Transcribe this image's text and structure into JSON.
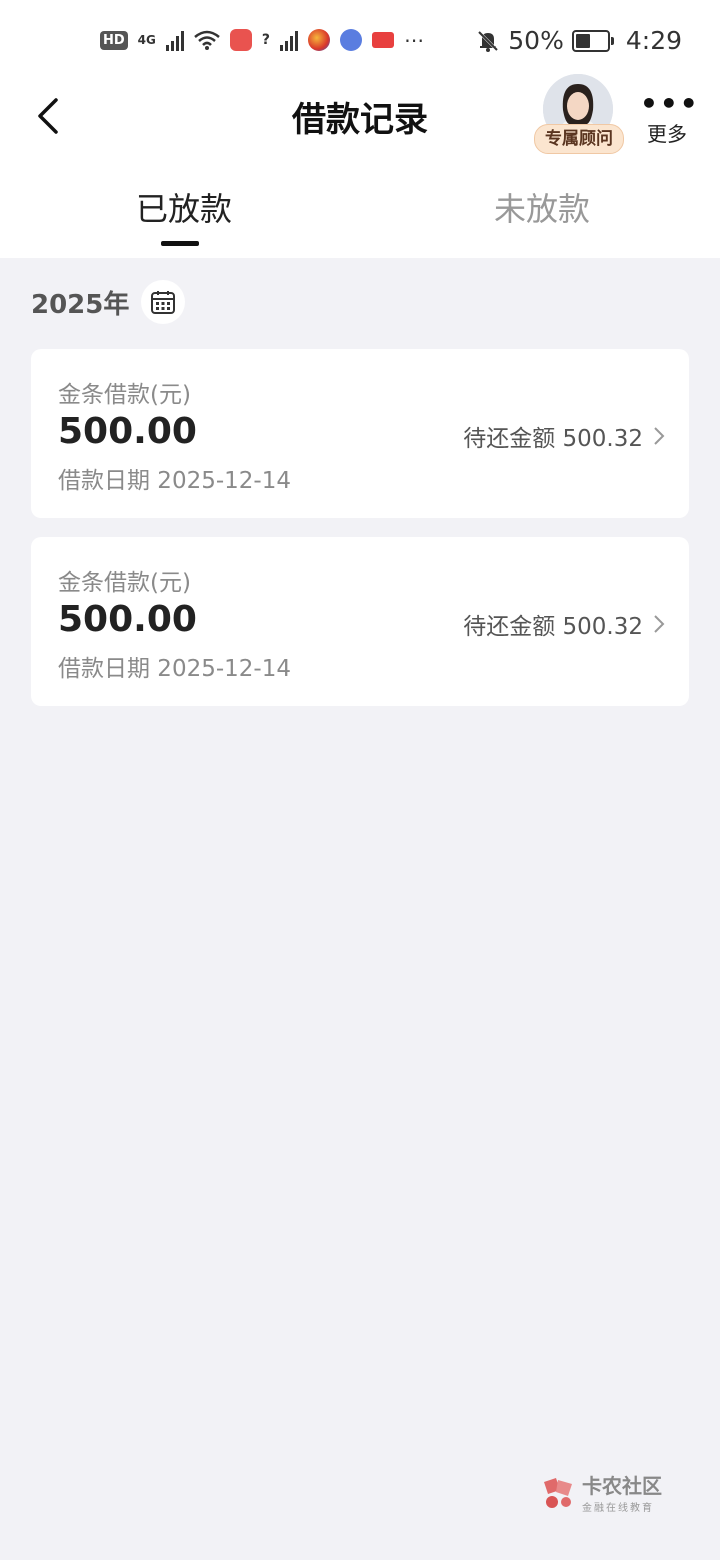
{
  "status_bar": {
    "hd": "HD",
    "network": "4G",
    "signal_unknown": "?",
    "battery_percent": "50%",
    "time": "4:29"
  },
  "header": {
    "title": "借款记录",
    "advisor_label": "专属顾问",
    "more_label": "更多"
  },
  "tabs": [
    {
      "label": "已放款",
      "active": true
    },
    {
      "label": "未放款",
      "active": false
    }
  ],
  "year": "2025年",
  "records": [
    {
      "label": "金条借款(元)",
      "amount": "500.00",
      "due": "待还金额 500.32",
      "date": "借款日期 2025-12-14"
    },
    {
      "label": "金条借款(元)",
      "amount": "500.00",
      "due": "待还金额 500.32",
      "date": "借款日期 2025-12-14"
    }
  ],
  "watermark": {
    "title": "卡农社区",
    "subtitle": "金融在线教育"
  },
  "colors": {
    "background": "#f2f2f6",
    "card": "#ffffff",
    "advisor_badge": "#fbe5cf"
  }
}
